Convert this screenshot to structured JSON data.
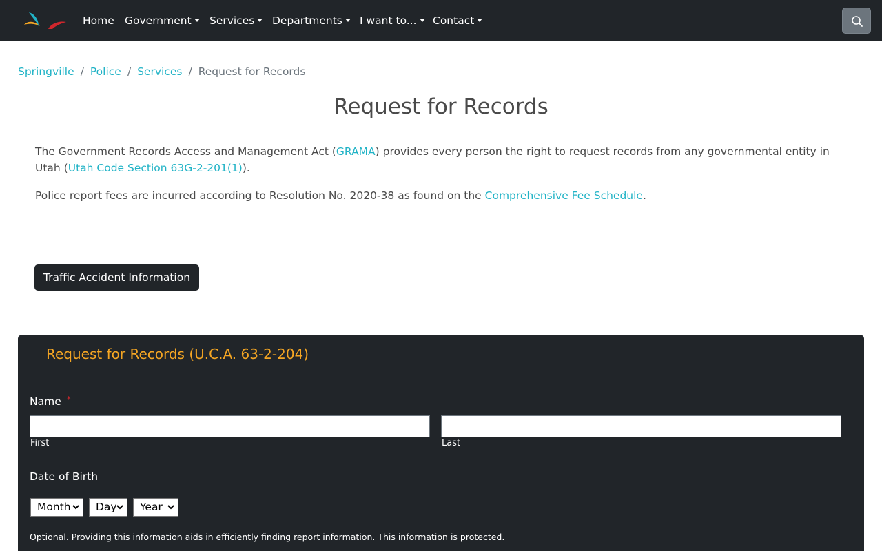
{
  "nav": {
    "items": [
      {
        "label": "Home",
        "dropdown": false
      },
      {
        "label": "Government",
        "dropdown": true
      },
      {
        "label": "Services",
        "dropdown": true
      },
      {
        "label": "Departments",
        "dropdown": true
      },
      {
        "label": "I want to...",
        "dropdown": true
      },
      {
        "label": "Contact",
        "dropdown": true
      }
    ],
    "search_icon": "search-icon"
  },
  "breadcrumb": {
    "items": [
      "Springville",
      "Police",
      "Services"
    ],
    "current": "Request for Records",
    "separator": "/"
  },
  "page_title": "Request for Records",
  "content": {
    "p1_before": "The Government Records Access and Management Act (",
    "p1_link1": "GRAMA",
    "p1_middle": ") provides every person the right to request records from any governmental entity in Utah (",
    "p1_link2": "Utah Code Section 63G-2-201(1)",
    "p1_after": ").",
    "p2_before": "Police report fees are incurred according to Resolution No. 2020-38 as found on the ",
    "p2_link": "Comprehensive Fee Schedule",
    "p2_after": "."
  },
  "traffic_button": "Traffic Accident Information",
  "form": {
    "title": "Request for Records (U.C.A. 63-2-204)",
    "name_label": "Name",
    "required_mark": "*",
    "first_sublabel": "First",
    "last_sublabel": "Last",
    "first_value": "",
    "last_value": "",
    "dob_label": "Date of Birth",
    "month_selected": "Month",
    "day_selected": "Day",
    "year_selected": "Year",
    "help_text": "Optional. Providing this information aids in efficiently finding report information. This information is protected."
  },
  "colors": {
    "navbar_bg": "#212529",
    "link": "#21b3c6",
    "form_title": "#f5a623",
    "required": "#d0262c",
    "search_btn": "#6c757d"
  }
}
